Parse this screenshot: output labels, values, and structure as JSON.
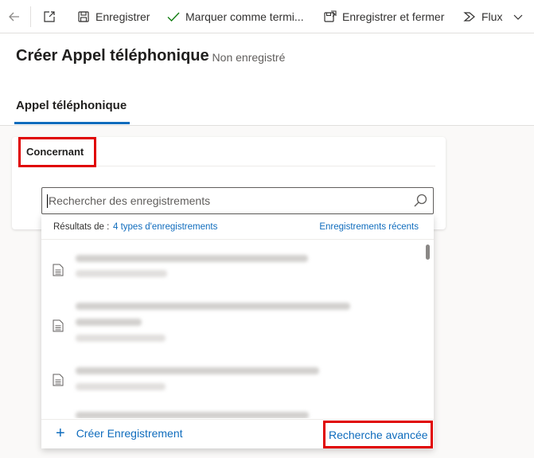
{
  "toolbar": {
    "back_icon": "back-arrow-icon",
    "popout_icon": "pop-out-icon",
    "save_label": "Enregistrer",
    "mark_complete_label": "Marquer comme termi...",
    "save_close_label": "Enregistrer et fermer",
    "flow_label": "Flux"
  },
  "header": {
    "title": "Créer Appel téléphonique",
    "subtitle": "- Non enregistré",
    "tab_label": "Appel téléphonique"
  },
  "section": {
    "title": "Concernant"
  },
  "search": {
    "placeholder": "Rechercher des enregistrements"
  },
  "flyout": {
    "results_label": "Résultats de :",
    "types_link": "4 types d'enregistrements",
    "recent_link": "Enregistrements récents",
    "create_label": "Créer Enregistrement",
    "advanced_search_label": "Recherche avancée"
  },
  "colors": {
    "accent": "#0f6cbd",
    "highlight_box": "#e00000"
  }
}
